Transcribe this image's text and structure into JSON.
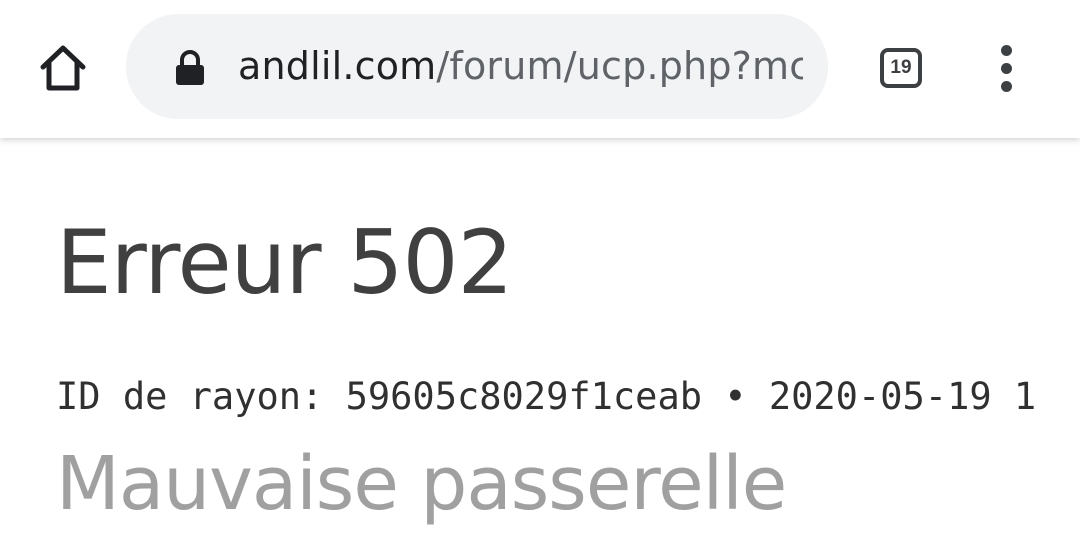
{
  "browser": {
    "url_domain": "andlil.com",
    "url_path": "/forum/ucp.php?mc",
    "tab_count": "19",
    "icons": {
      "home": "home-icon",
      "lock": "lock-icon",
      "tabs": "tab-switcher-icon",
      "menu": "more-vert-icon"
    }
  },
  "page": {
    "title": "Erreur 502",
    "ray_label": "ID de rayon:",
    "ray_id": "59605c8029f1ceab",
    "separator": "•",
    "timestamp": "2020-05-19 1",
    "subtitle": "Mauvaise passerelle"
  }
}
